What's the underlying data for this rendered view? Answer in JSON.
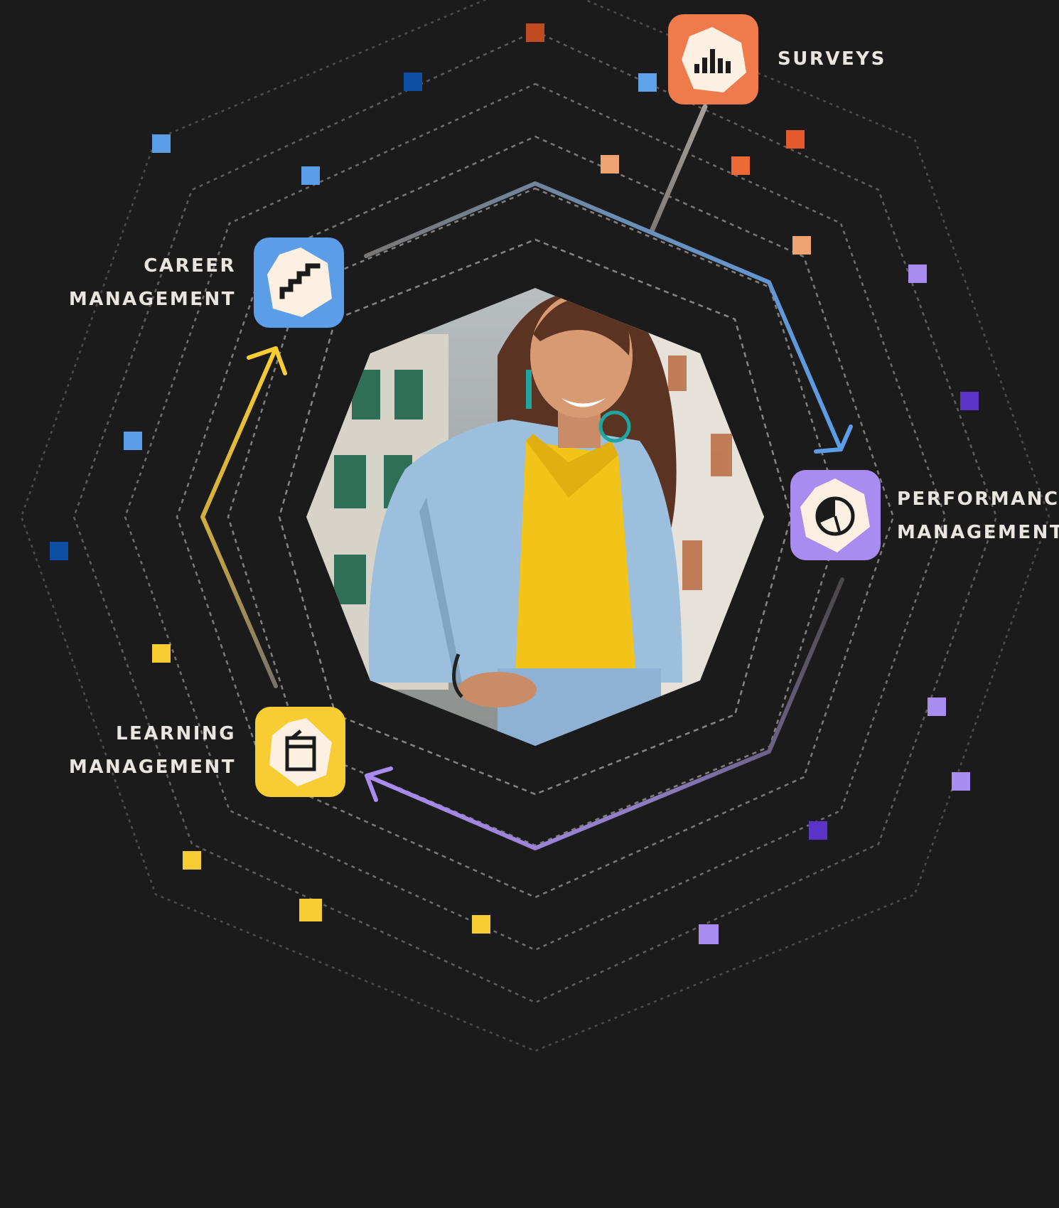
{
  "nodes": {
    "surveys": {
      "lines": [
        "SURVEYS"
      ],
      "color": "#ef7b4c",
      "icon": "bar-chart-icon"
    },
    "career": {
      "lines": [
        "CAREER",
        "MANAGEMENT"
      ],
      "color": "#5c9de8",
      "icon": "stairs-icon"
    },
    "performance": {
      "lines": [
        "PERFORMANCE",
        "MANAGEMENT"
      ],
      "color": "#a98cf0",
      "icon": "pie-chart-icon"
    },
    "learning": {
      "lines": [
        "LEARNING",
        "MANAGEMENT"
      ],
      "color": "#f8cd33",
      "icon": "book-icon"
    }
  },
  "cycle_arrows": [
    {
      "from": "career",
      "to": "performance",
      "color": "#5c9de8"
    },
    {
      "from": "performance",
      "to": "learning",
      "color": "#a98cf0"
    },
    {
      "from": "learning",
      "to": "career",
      "color": "#f8cd33"
    }
  ],
  "link": {
    "from": "surveys",
    "to": "cycle",
    "color": "#9a9693"
  },
  "photo": {
    "subject": "smiling-person-in-denim-jacket"
  },
  "colors": {
    "background": "#1b1b1c",
    "tile_inner": "#fbf0e1",
    "dotted_rings": "#8b8887",
    "label_text": "#e9e6e1"
  }
}
